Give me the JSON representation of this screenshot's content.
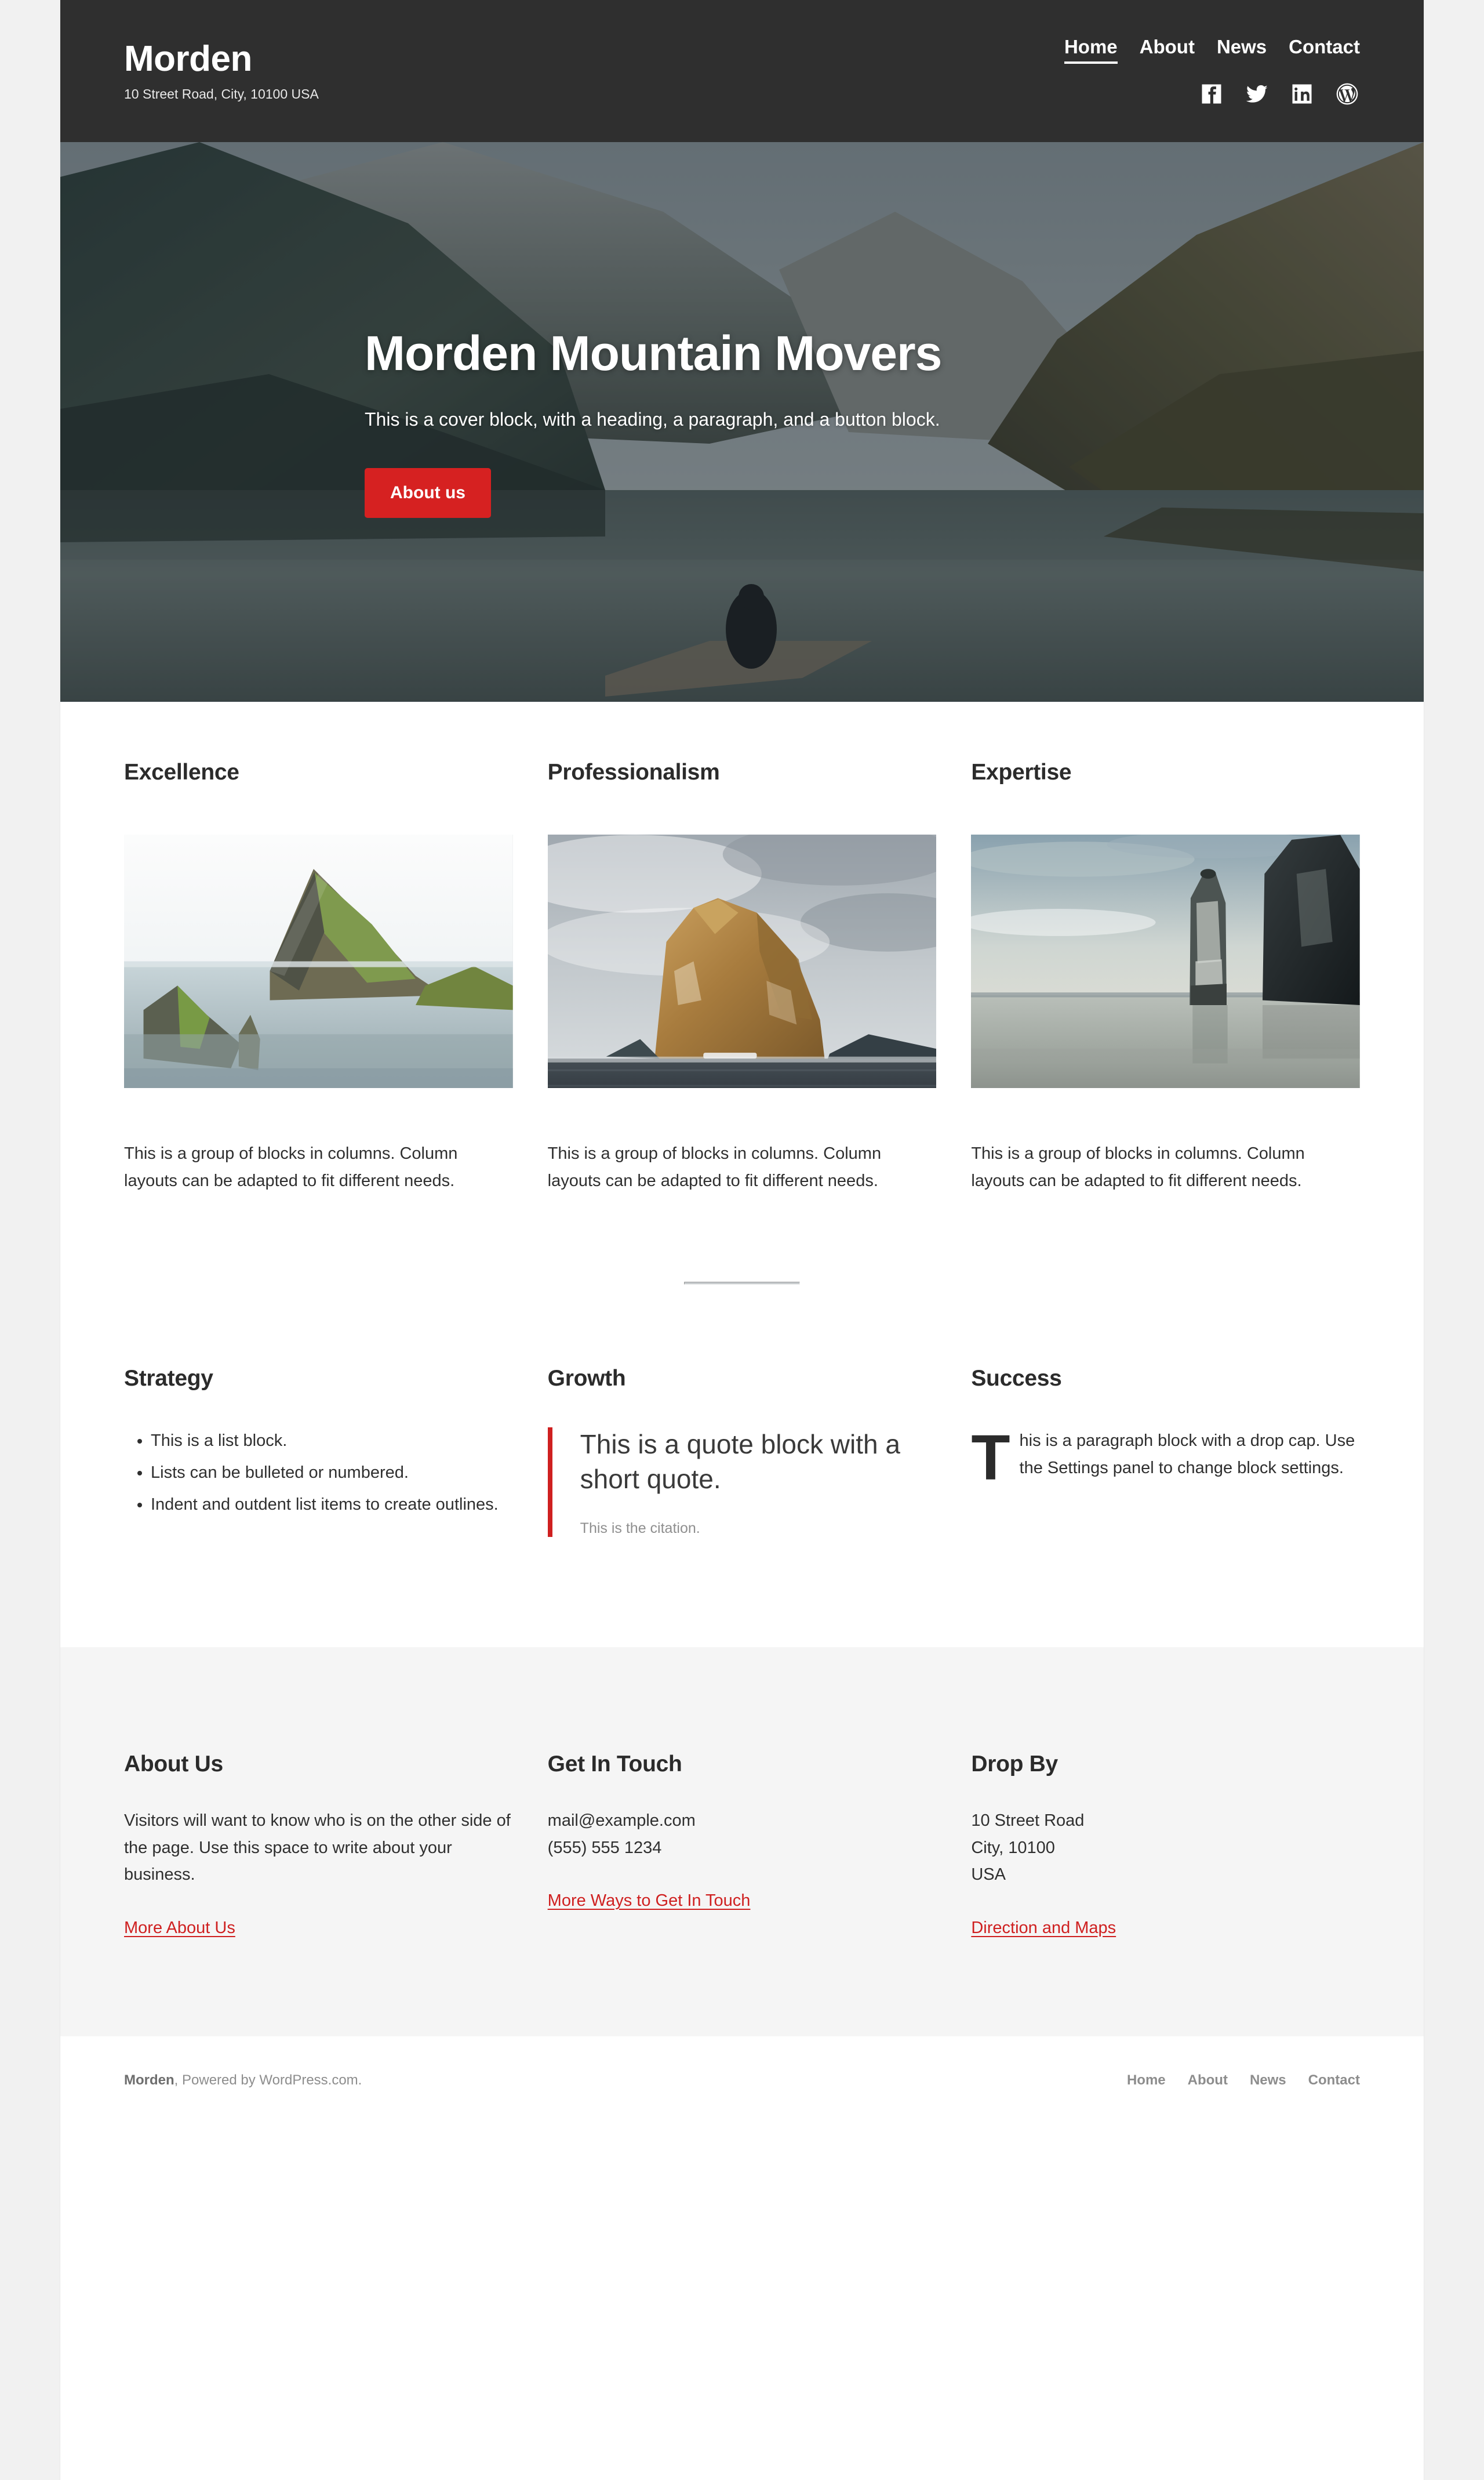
{
  "site": {
    "title": "Morden",
    "tagline": "10 Street Road, City, 10100 USA",
    "accent_color": "#d62121",
    "header_bg": "#2f2f2f",
    "footer_bg": "#f5f5f5"
  },
  "nav": {
    "items": [
      {
        "label": "Home",
        "current": true
      },
      {
        "label": "About",
        "current": false
      },
      {
        "label": "News",
        "current": false
      },
      {
        "label": "Contact",
        "current": false
      }
    ]
  },
  "social": [
    {
      "name": "facebook-icon",
      "label": "Facebook"
    },
    {
      "name": "twitter-icon",
      "label": "Twitter"
    },
    {
      "name": "linkedin-icon",
      "label": "LinkedIn"
    },
    {
      "name": "wordpress-icon",
      "label": "WordPress"
    }
  ],
  "cover": {
    "heading": "Morden Mountain Movers",
    "paragraph": "This is a cover block, with a heading, a paragraph, and a button block.",
    "button_label": "About us"
  },
  "features": {
    "columns": [
      {
        "heading": "Excellence",
        "body": "This is a group of blocks in columns. Column layouts can be adapted to fit different needs.",
        "image_alt": "Green sea stack island rising from calm ocean under misty sky"
      },
      {
        "heading": "Professionalism",
        "body": "This is a group of blocks in columns. Column layouts can be adapted to fit different needs.",
        "image_alt": "Large golden rock monolith in dark sea beneath cloudy sky"
      },
      {
        "heading": "Expertise",
        "body": "This is a group of blocks in columns. Column layouts can be adapted to fit different needs.",
        "image_alt": "Tall sea stack and cliff at dusk over glassy water"
      }
    ]
  },
  "blocks": {
    "strategy": {
      "heading": "Strategy",
      "list": [
        "This is a list block.",
        "Lists can be bulleted or numbered.",
        "Indent and outdent list items to create outlines."
      ]
    },
    "growth": {
      "heading": "Growth",
      "quote": "This is a quote block with a short quote.",
      "citation": "This is the citation."
    },
    "success": {
      "heading": "Success",
      "paragraph": "This is a paragraph block with a drop cap. Use the Settings panel to change block settings."
    }
  },
  "footer": {
    "about": {
      "heading": "About Us",
      "body": "Visitors will want to know who is on the other side of the page. Use this space to write about your business.",
      "link": "More About Us"
    },
    "contact": {
      "heading": "Get In Touch",
      "email": "mail@example.com",
      "phone": "(555) 555 1234",
      "link": "More Ways to Get In Touch"
    },
    "address": {
      "heading": "Drop By",
      "line1": "10 Street Road",
      "line2": "City, 10100",
      "line3": "USA",
      "link": "Direction and Maps"
    },
    "colophon_brand": "Morden",
    "colophon_rest": ", Powered by WordPress.com.",
    "bottom_nav": [
      "Home",
      "About",
      "News",
      "Contact"
    ]
  }
}
